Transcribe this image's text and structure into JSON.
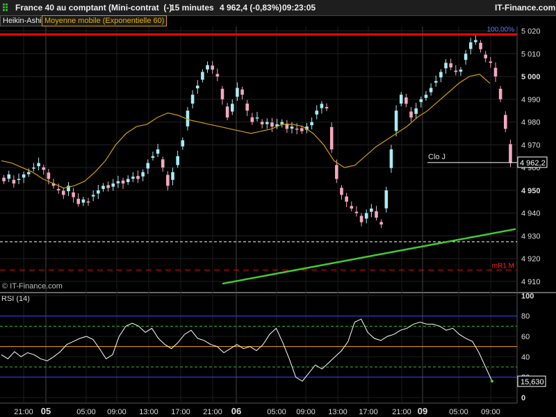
{
  "window": {
    "title": "France 40 au comptant (Mini-contrat  (-)",
    "interval": "15 minutes",
    "last_quote": "4 962,4 (-0,83%)",
    "time": "09:23:05",
    "brand": "IT-Finance.com"
  },
  "legend": {
    "type_label": "Heikin-Ashi",
    "ma_label": "Moyenne mobile (Exponentielle 60)"
  },
  "colors": {
    "up_candle": "#a8ecf4",
    "down_candle": "#f5a8c0",
    "ma": "#d4a000",
    "top_resistance": "#ff0000",
    "trendline": "#44cc33",
    "rsi_line": "#ffffff",
    "rsi_band_outer": "#3344ff",
    "rsi_band_mid": "#ffa500",
    "rsi_band_inner": "#33bb33"
  },
  "annotations": {
    "top_pct": "100,00%",
    "clo_label": "Clo J",
    "last_price_tag": "4 962,2",
    "mr1_label": "mR1 M",
    "watermark": "© IT-Finance.com",
    "rsi_title": "RSI (14)",
    "rsi_last_tag": "15,630"
  },
  "chart_data": [
    {
      "type": "candlestick",
      "subtype": "heikin-ashi",
      "title": "France 40 au comptant (Mini-contrat  (-)",
      "y_ticks": [
        "5 020",
        "5 010",
        "5 000",
        "4 990",
        "4 980",
        "4 970",
        "4 960",
        "4 950",
        "4 940",
        "4 930",
        "4 920",
        "4 910"
      ],
      "ylim": [
        4906,
        5022
      ],
      "x_ticks": [
        "21:00",
        "05",
        "05:00",
        "09:00",
        "13:00",
        "17:00",
        "21:00",
        "06",
        "05:00",
        "09:00",
        "13:00",
        "17:00",
        "21:00",
        "09",
        "05:00",
        "09:00"
      ],
      "closes": [
        4954,
        4957,
        4953,
        4955,
        4957,
        4958,
        4960,
        4962,
        4959,
        4955,
        4952,
        4950,
        4948,
        4952,
        4947,
        4944,
        4946,
        4945,
        4948,
        4950,
        4952,
        4951,
        4953,
        4954,
        4953,
        4955,
        4956,
        4955,
        4958,
        4962,
        4965,
        4968,
        4960,
        4952,
        4958,
        4965,
        4972,
        4985,
        4992,
        4996,
        5002,
        5005,
        5003,
        5000,
        4990,
        4982,
        4988,
        4995,
        4992,
        4985,
        4980,
        4982,
        4979,
        4980,
        4978,
        4979,
        4980,
        4977,
        4978,
        4977,
        4976,
        4978,
        4980,
        4985,
        4988,
        4986,
        4968,
        4955,
        4948,
        4945,
        4942,
        4940,
        4936,
        4940,
        4942,
        4938,
        4935,
        4950,
        4968,
        4985,
        4992,
        4988,
        4982,
        4986,
        4990,
        4992,
        4995,
        4998,
        5002,
        5006,
        5004,
        5002,
        5003,
        5010,
        5015,
        5016,
        5012,
        5008,
        5006,
        5000,
        4990,
        4977,
        4962
      ],
      "ma_series": {
        "name": "Moyenne mobile (Exponentielle 60)",
        "values": [
          4963,
          4962,
          4960,
          4958,
          4955,
          4953,
          4951,
          4952,
          4954,
          4958,
          4963,
          4970,
          4975,
          4978,
          4979,
          4982,
          4984,
          4983,
          4981,
          4980,
          4979,
          4978,
          4977,
          4976,
          4975,
          4976,
          4977,
          4979,
          4979,
          4978,
          4975,
          4970,
          4963,
          4960,
          4961,
          4965,
          4969,
          4972,
          4975,
          4978,
          4982,
          4985,
          4989,
          4993,
          4997,
          5000,
          5001,
          4997
        ]
      },
      "levels": [
        {
          "label": "100,00%",
          "value": 5018.5,
          "color": "#ff0000",
          "style": "solid"
        },
        {
          "label": "Clo J",
          "value": 4962.2,
          "color": "#ffffff",
          "style": "solid"
        },
        {
          "label": "",
          "value": 4927.4,
          "color": "#ffffff",
          "style": "dashed"
        },
        {
          "label": "mR1 M",
          "value": 4915,
          "color": "#ff0000",
          "style": "dashed"
        }
      ],
      "trendline": {
        "from_date_label": "21:00 (05)",
        "from_value": 4909,
        "to_value": 4933,
        "color": "#44cc33"
      },
      "last_value": 4962.2,
      "grid": true
    },
    {
      "type": "line",
      "title": "RSI (14)",
      "y_ticks": [
        "100",
        "80",
        "60",
        "40",
        "20",
        "0"
      ],
      "ylim": [
        0,
        100
      ],
      "bands": [
        80,
        70,
        50,
        30,
        20
      ],
      "series": [
        {
          "name": "RSI (14)",
          "values": [
            42,
            38,
            45,
            40,
            44,
            42,
            38,
            36,
            40,
            45,
            52,
            55,
            58,
            60,
            57,
            48,
            38,
            42,
            60,
            70,
            73,
            70,
            64,
            68,
            58,
            52,
            48,
            54,
            62,
            66,
            58,
            56,
            52,
            50,
            44,
            48,
            52,
            48,
            50,
            46,
            52,
            62,
            68,
            54,
            38,
            20,
            16,
            24,
            32,
            28,
            34,
            40,
            46,
            55,
            74,
            77,
            64,
            58,
            56,
            60,
            62,
            66,
            68,
            72,
            74,
            72,
            72,
            70,
            66,
            68,
            62,
            58,
            55,
            44,
            30,
            16
          ]
        }
      ],
      "last_value": 15.63,
      "grid": true
    }
  ]
}
